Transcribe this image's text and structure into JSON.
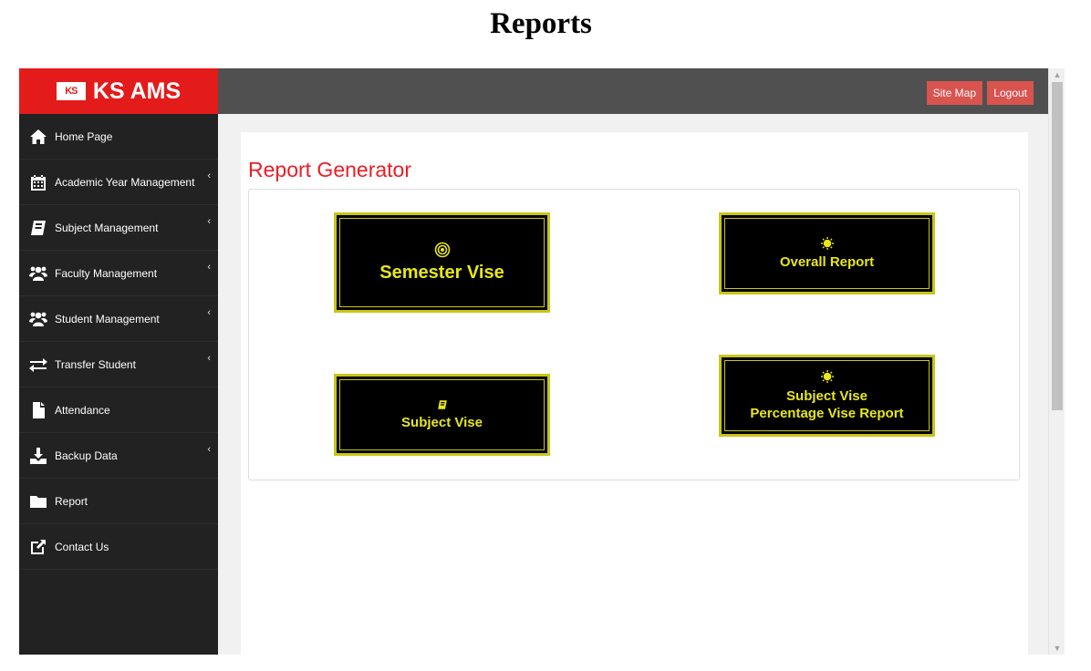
{
  "page_heading": "Reports",
  "brand": {
    "logo_text": "KS",
    "name": "KS AMS"
  },
  "topbar": {
    "site_map": "Site Map",
    "logout": "Logout"
  },
  "sidebar": {
    "items": [
      {
        "label": "Home Page",
        "icon": "home-icon",
        "has_submenu": false
      },
      {
        "label": "Academic Year Management",
        "icon": "calendar-icon",
        "has_submenu": true
      },
      {
        "label": "Subject Management",
        "icon": "book-icon",
        "has_submenu": true
      },
      {
        "label": "Faculty Management",
        "icon": "users-icon",
        "has_submenu": true
      },
      {
        "label": "Student Management",
        "icon": "users-icon",
        "has_submenu": true
      },
      {
        "label": "Transfer Student",
        "icon": "exchange-icon",
        "has_submenu": true
      },
      {
        "label": "Attendance",
        "icon": "file-icon",
        "has_submenu": false
      },
      {
        "label": "Backup Data",
        "icon": "download-icon",
        "has_submenu": true
      },
      {
        "label": "Report",
        "icon": "folder-icon",
        "has_submenu": false
      },
      {
        "label": "Contact Us",
        "icon": "external-link-icon",
        "has_submenu": false
      }
    ],
    "caret": "‹"
  },
  "main": {
    "title": "Report Generator",
    "cards": {
      "semester": {
        "label": "Semester Vise",
        "icon": "target-icon"
      },
      "overall": {
        "label": "Overall Report",
        "icon": "sun-icon"
      },
      "subject": {
        "label": "Subject Vise",
        "icon": "book-icon"
      },
      "subject_pct": {
        "line1": "Subject Vise",
        "line2": "Percentage Vise Report",
        "icon": "sun-icon"
      }
    }
  },
  "colors": {
    "brand_red": "#e41b1b",
    "title_red": "#ee1c24",
    "card_yellow": "#e8e71a",
    "button_red": "#d9534f"
  }
}
